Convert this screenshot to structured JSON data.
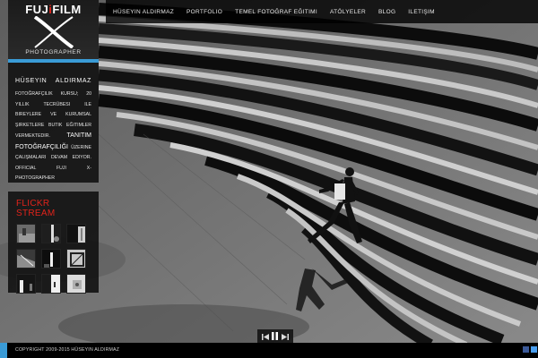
{
  "brand": {
    "name_left": "FUJ",
    "name_right": "FILM",
    "tagline": "PHOTOGRAPHER"
  },
  "nav": {
    "items": [
      "HÜSEYIN ALDIRMAZ",
      "PORTFOLIO",
      "TEMEL FOTOĞRAF EĞITIMI",
      "ATÖLYELER",
      "BLOG",
      "ILETIŞIM"
    ]
  },
  "about": {
    "first_name": "HÜSEYIN",
    "last_name": "ALDIRMAZ",
    "text_part1": "FOTOĞRAFÇILIK KURSU; 20 YILLIK TECRÜBESI ILE BIREYLERE VE KURUMSAL ŞIRKETLERE BUTIK EĞITIMLER VERMEKTEDIR.",
    "text_big": "TANITIM FOTOĞRAFÇILIĞI",
    "text_part2": "ÜZERINE ÇALIŞMALARI DEVAM EDIYOR. OFFICIAL FUJI X-PHOTOGRAPHER"
  },
  "flickr": {
    "title": "FLICKR STREAM",
    "thumbnails": [
      "thumb-1",
      "thumb-2",
      "thumb-3",
      "thumb-4",
      "thumb-5",
      "thumb-6",
      "thumb-7",
      "thumb-8",
      "thumb-9"
    ]
  },
  "footer": {
    "copyright": "COPYRIGHT 2009-2015 HÜSEYIN ALDIRMAZ"
  },
  "player": {
    "icons": [
      "previous-icon",
      "pause-icon",
      "next-icon"
    ]
  },
  "social": {
    "icons": [
      "facebook-icon",
      "twitter-icon"
    ]
  },
  "colors": {
    "accent_blue": "#3a9bd6",
    "flickr_red": "#e2231a",
    "panel_bg": "#0f0f0f"
  }
}
